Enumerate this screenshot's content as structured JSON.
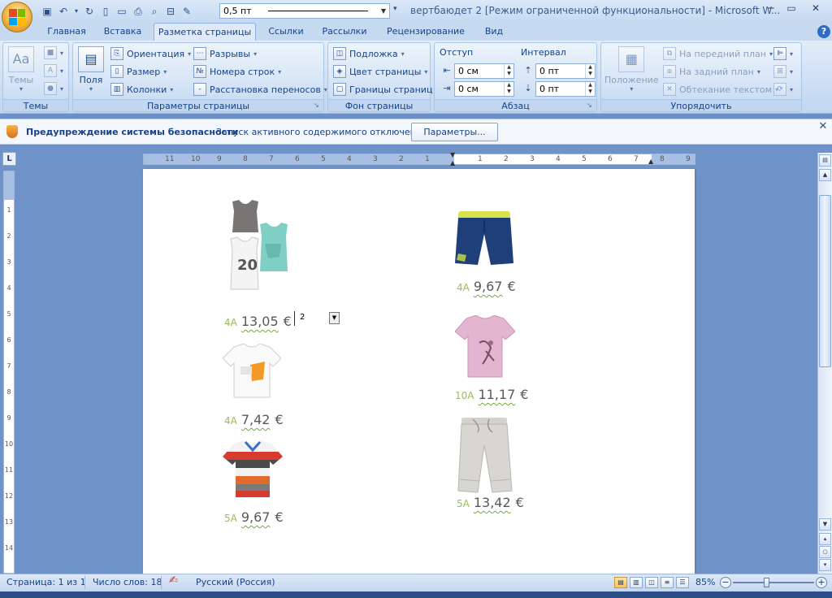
{
  "window": {
    "title": "вертбаюдет 2 [Режим ограниченной функциональности] - Microsoft W...",
    "font_size_value": "0,5 пт"
  },
  "tabs": [
    {
      "label": "Главная"
    },
    {
      "label": "Вставка"
    },
    {
      "label": "Разметка страницы",
      "active": true
    },
    {
      "label": "Ссылки"
    },
    {
      "label": "Рассылки"
    },
    {
      "label": "Рецензирование"
    },
    {
      "label": "Вид"
    }
  ],
  "ribbon": {
    "themes": {
      "label": "Темы",
      "button": "Темы"
    },
    "page_setup": {
      "label": "Параметры страницы",
      "margins": "Поля",
      "orientation": "Ориентация",
      "size": "Размер",
      "columns": "Колонки",
      "breaks": "Разрывы",
      "line_numbers": "Номера строк",
      "hyphenation": "Расстановка переносов"
    },
    "page_background": {
      "label": "Фон страницы",
      "watermark": "Подложка",
      "page_color": "Цвет страницы",
      "page_borders": "Границы страниц"
    },
    "paragraph": {
      "label": "Абзац",
      "indent_head": "Отступ",
      "spacing_head": "Интервал",
      "indent_left": "0 см",
      "indent_right": "0 см",
      "spacing_before": "0 пт",
      "spacing_after": "0 пт"
    },
    "arrange": {
      "label": "Упорядочить",
      "position": "Положение",
      "bring_front": "На передний план",
      "send_back": "На задний план",
      "text_wrap": "Обтекание текстом"
    }
  },
  "security_bar": {
    "title": "Предупреждение системы безопасности",
    "message": "Запуск активного содержимого отключен.",
    "button": "Параметры..."
  },
  "ruler": {
    "corner": "L",
    "left_numbers": [
      "11",
      "10",
      "9",
      "8",
      "7",
      "6",
      "5",
      "4",
      "3",
      "2",
      "1"
    ],
    "right_numbers": [
      "1",
      "2",
      "3",
      "4",
      "5",
      "6",
      "7",
      "8",
      "9"
    ],
    "vertical_numbers": [
      "1",
      "2",
      "3",
      "4",
      "5",
      "6",
      "7",
      "8",
      "9",
      "10",
      "11",
      "12",
      "13",
      "14"
    ]
  },
  "products": [
    {
      "size": "4A",
      "price": "13,05",
      "currency": "€",
      "item": "tank tops"
    },
    {
      "size": "4A",
      "price": "9,67",
      "currency": "€",
      "item": "navy shorts"
    },
    {
      "size": "4A",
      "price": "7,42",
      "currency": "€",
      "item": "white t-shirt"
    },
    {
      "size": "10A",
      "price": "11,17",
      "currency": "€",
      "item": "pink t-shirt"
    },
    {
      "size": "5A",
      "price": "9,67",
      "currency": "€",
      "item": "striped polo"
    },
    {
      "size": "5A",
      "price": "13,42",
      "currency": "€",
      "item": "beige trousers"
    }
  ],
  "dropdown_field": {
    "value": "2"
  },
  "status_bar": {
    "page": "Страница: 1 из 1",
    "word_count": "Число слов: 18",
    "language": "Русский (Россия)",
    "zoom": "85%"
  },
  "colors": {
    "size_green": "#9bbb59",
    "price_gray": "#595959",
    "ribbon_text": "#15428b"
  }
}
